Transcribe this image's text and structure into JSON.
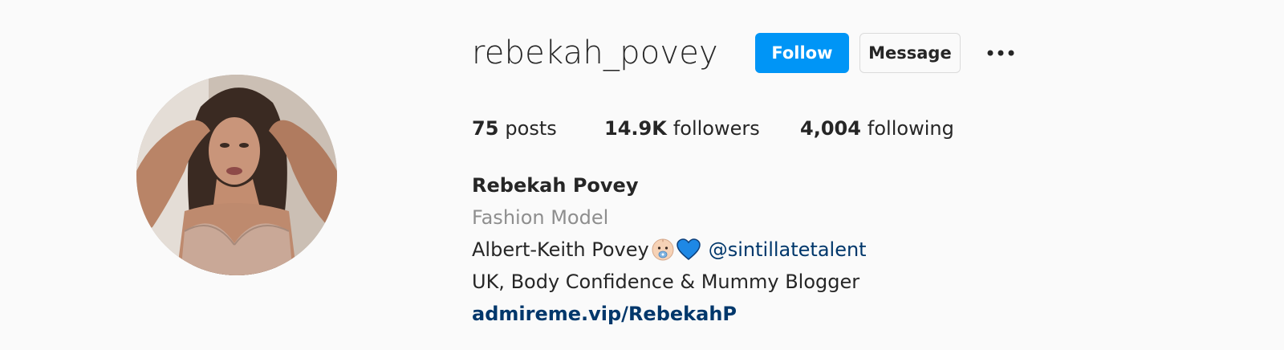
{
  "profile": {
    "username": "rebekah_povey",
    "display_name": "Rebekah Povey",
    "category": "Fashion Model",
    "avatar_alt": "profile-photo"
  },
  "actions": {
    "follow_label": "Follow",
    "message_label": "Message",
    "more_icon": "more-options-icon"
  },
  "stats": {
    "posts": {
      "value": "75",
      "label": "posts"
    },
    "followers": {
      "value": "14.9K",
      "label": "followers"
    },
    "following": {
      "value": "4,004",
      "label": "following"
    }
  },
  "bio": {
    "line1_text": "Albert-Keith Povey",
    "line1_emojis": [
      "baby-face-emoji",
      "blue-heart-emoji"
    ],
    "line1_mention": "@sintillatetalent",
    "line2": "UK, Body Confidence & Mummy Blogger",
    "link": "admireme.vip/RebekahP"
  },
  "colors": {
    "follow_bg": "#0095f6",
    "link": "#00376b",
    "muted": "#8e8e8e",
    "text": "#262626",
    "background": "#fafafa"
  }
}
